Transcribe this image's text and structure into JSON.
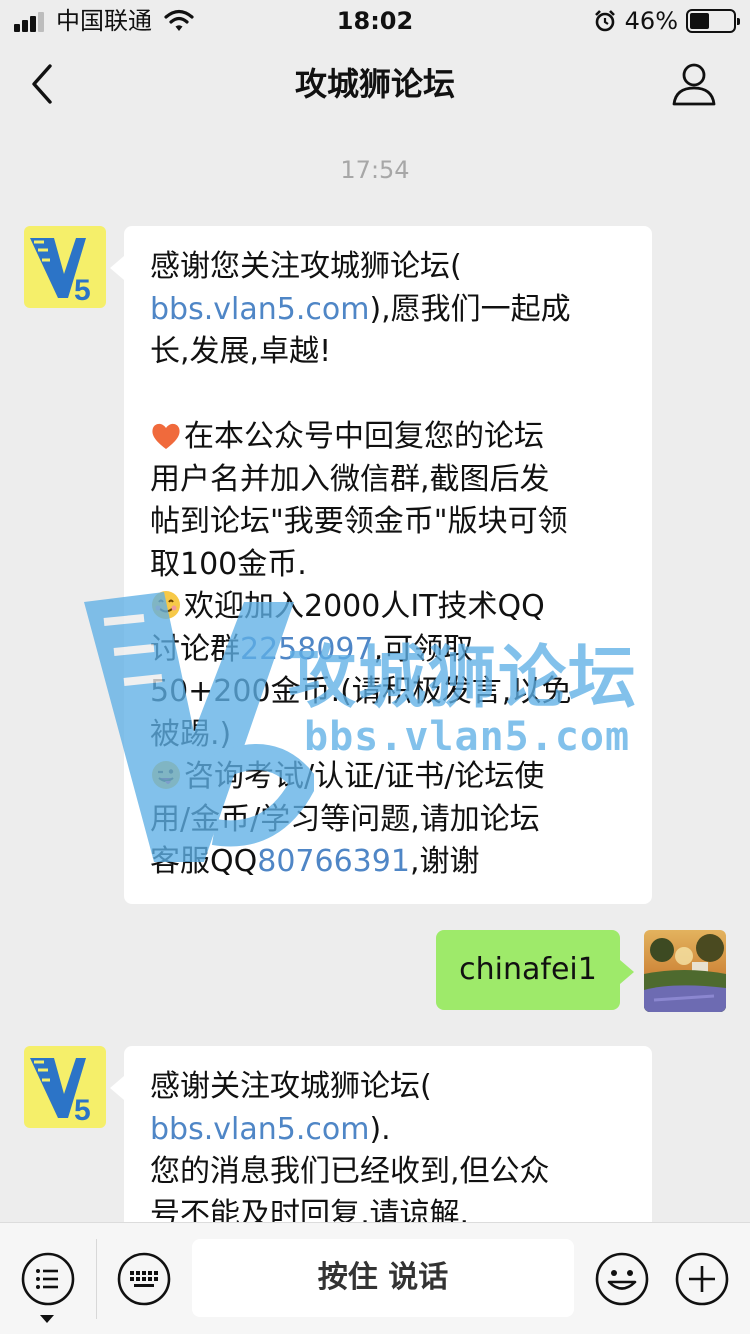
{
  "status_bar": {
    "carrier": "中国联通",
    "time": "18:02",
    "battery_percent_text": "46%",
    "battery_level": 0.46
  },
  "nav": {
    "title": "攻城狮论坛"
  },
  "chat": {
    "timestamp": "17:54",
    "messages": [
      {
        "from": "official-account",
        "lines": [
          [
            "感谢您关注攻城狮论坛("
          ],
          [
            "bbs.vlan5.com",
            "),愿我们一起成"
          ],
          [
            "长,发展,卓越!"
          ],
          [
            ""
          ],
          [
            "在本公众号中回复您的论坛"
          ],
          [
            "用户名并加入微信群,截图后发"
          ],
          [
            "帖到论坛\"我要领金币\"版块可领"
          ],
          [
            "取100金币."
          ],
          [
            "欢迎加入2000人IT技术QQ"
          ],
          [
            "讨论群",
            "2258097",
            ",可领取"
          ],
          [
            "50+200金币.(请积极发言,以免"
          ],
          [
            "被踢.)"
          ],
          [
            "咨询考试/认证/证书/论坛使"
          ],
          [
            "用/金币/学习等问题,请加论坛"
          ],
          [
            "客服QQ",
            "80766391",
            ",谢谢"
          ]
        ]
      },
      {
        "from": "me",
        "text": "chinafei1"
      },
      {
        "from": "official-account",
        "lines": [
          [
            "感谢关注攻城狮论坛("
          ],
          [
            "bbs.vlan5.com",
            ")."
          ],
          [
            "您的消息我们已经收到,但公众"
          ],
          [
            "号不能及时回复,请谅解."
          ]
        ]
      }
    ],
    "watermark": {
      "cn": "攻城狮论坛",
      "url": "bbs.vlan5.com"
    }
  },
  "input_bar": {
    "talk_label": "按住 说话"
  },
  "colors": {
    "link": "#4f86c6",
    "outgoing_bubble": "#9eea6a",
    "background": "#ededed"
  }
}
